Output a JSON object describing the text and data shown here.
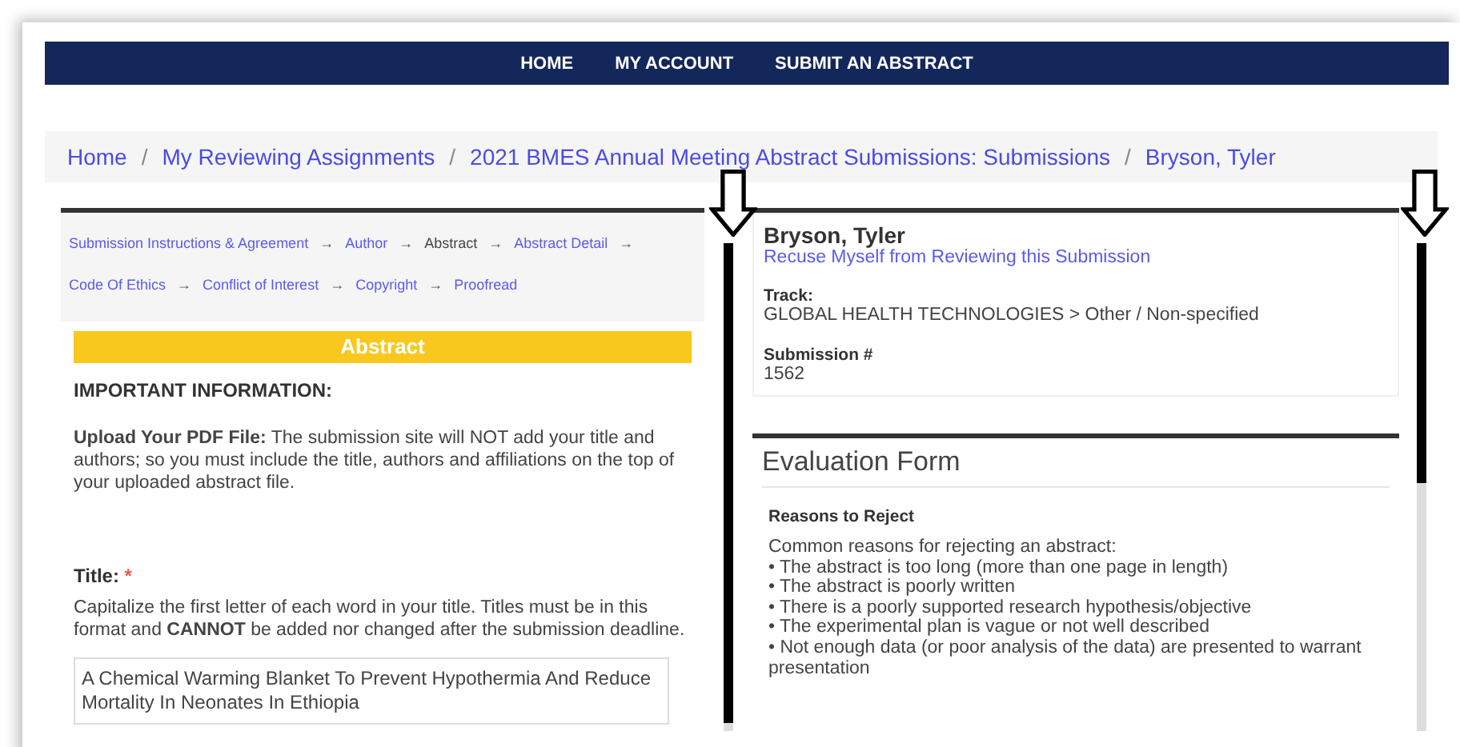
{
  "nav": {
    "items": [
      "HOME",
      "MY ACCOUNT",
      "SUBMIT AN ABSTRACT"
    ]
  },
  "breadcrumb": [
    "Home",
    "My Reviewing Assignments",
    "2021 BMES Annual Meeting Abstract Submissions: Submissions",
    "Bryson, Tyler"
  ],
  "breadcrumb_separator": "/",
  "steps": [
    {
      "label": "Submission Instructions & Agreement",
      "selected": false
    },
    {
      "label": "Author",
      "selected": false
    },
    {
      "label": "Abstract",
      "selected": true
    },
    {
      "label": "Abstract Detail",
      "selected": false
    },
    {
      "label": "Code Of Ethics",
      "selected": false
    },
    {
      "label": "Conflict of Interest",
      "selected": false
    },
    {
      "label": "Copyright",
      "selected": false
    },
    {
      "label": "Proofread",
      "selected": false
    }
  ],
  "step_separator": "→",
  "abstract": {
    "heading": "Abstract",
    "important": "IMPORTANT INFORMATION:",
    "upload_note": "**Upload Your PDF File:** The submission site will NOT add your title and authors; so you must include the title, authors and affiliations on the top of your uploaded abstract file.",
    "title_label": "Title:",
    "required_mark": "*",
    "title_help": "Capitalize the first letter of each word in your title. Titles must be in this format and **CANNOT** be added nor changed after the submission deadline.",
    "title_value": "A Chemical Warming Blanket To Prevent Hypothermia And Reduce Mortality In Neonates In Ethiopia"
  },
  "submission": {
    "name": "Bryson, Tyler",
    "recuse_link": "Recuse Myself from Reviewing this Submission",
    "track_label": "Track:",
    "track": "GLOBAL HEALTH TECHNOLOGIES > Other / Non-specified",
    "number_label": "Submission #",
    "number": "1562"
  },
  "evaluation": {
    "heading": "Evaluation Form",
    "section": "Reasons to Reject",
    "intro": "Common reasons for rejecting an abstract:",
    "reasons": [
      "• The abstract is too long (more than one page in length)",
      "• The abstract is poorly written",
      "• There is a poorly supported research hypothesis/objective",
      "• The experimental plan is vague or not well described",
      "• Not enough data (or poor analysis of the data) are presented to warrant presentation"
    ]
  }
}
